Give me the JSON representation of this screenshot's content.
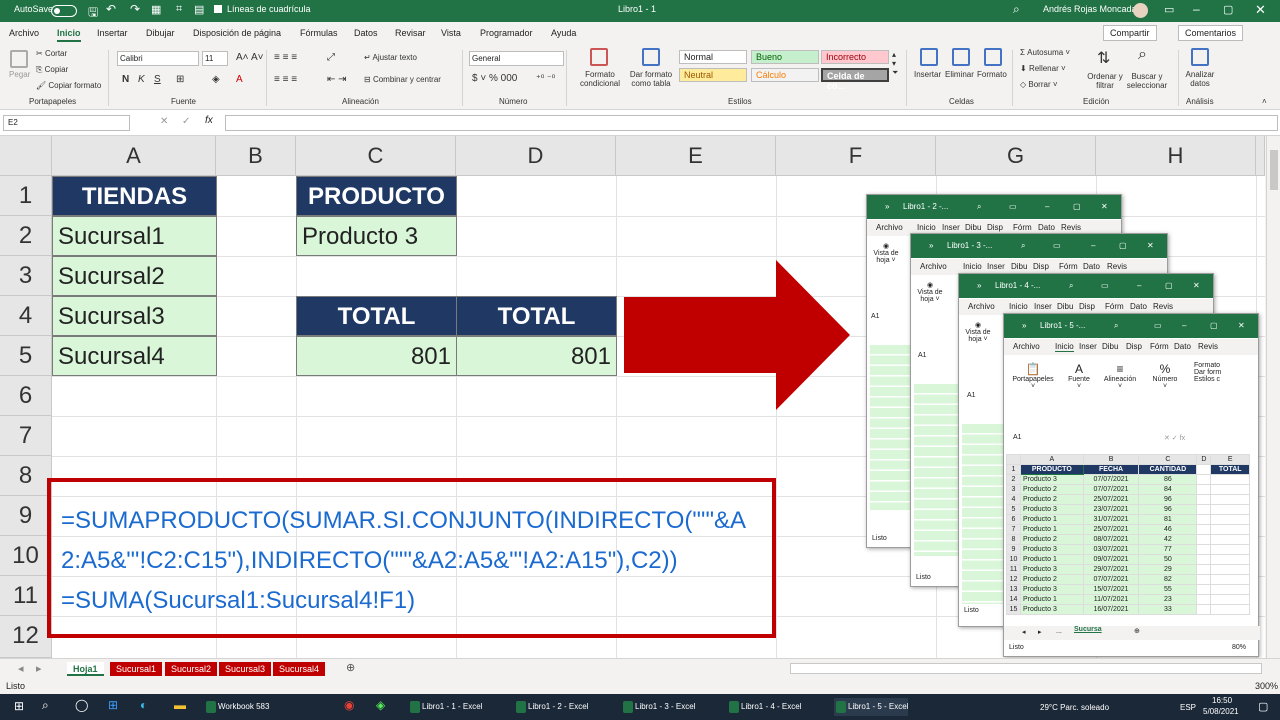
{
  "title_bar": {
    "autosave": "AutoSave",
    "gridlines": "Líneas de cuadrícula",
    "doc_title": "Libro1 - 1",
    "search": "⌕",
    "user": "Andrés Rojas Moncada"
  },
  "ribbon_tabs": [
    "Archivo",
    "Inicio",
    "Insertar",
    "Dibujar",
    "Disposición de página",
    "Fórmulas",
    "Datos",
    "Revisar",
    "Vista",
    "Programador",
    "Ayuda"
  ],
  "share": "Compartir",
  "comments": "Comentarios",
  "ribbon": {
    "clipboard": {
      "paste": "Pegar",
      "cut": "Cortar",
      "copy": "Copiar",
      "format_painter": "Copiar formato",
      "group": "Portapapeles"
    },
    "font": {
      "family": "Calibri",
      "size": "11",
      "bold": "N",
      "italic": "K",
      "underline": "S",
      "group": "Fuente"
    },
    "alignment": {
      "wrap": "Ajustar texto",
      "merge": "Combinar y centrar",
      "group": "Alineación"
    },
    "number": {
      "format": "General",
      "group": "Número"
    },
    "styles": {
      "cond": "Formato condicional",
      "table": "Dar formato como tabla",
      "normal": "Normal",
      "good": "Bueno",
      "bad": "Incorrecto",
      "neutral": "Neutral",
      "calc": "Cálculo",
      "check": "Celda de co...",
      "group": "Estilos"
    },
    "cells": {
      "insert": "Insertar",
      "delete": "Eliminar",
      "format": "Formato",
      "group": "Celdas"
    },
    "editing": {
      "autosum": "Autosuma",
      "fill": "Rellenar",
      "clear": "Borrar",
      "sort": "Ordenar y filtrar",
      "find": "Buscar y seleccionar",
      "group": "Edición"
    },
    "analysis": {
      "analyze": "Analizar datos",
      "group": "Análisis"
    }
  },
  "name_box": "E2",
  "columns": [
    "A",
    "B",
    "C",
    "D",
    "E",
    "F",
    "G",
    "H"
  ],
  "rows": [
    "1",
    "2",
    "3",
    "4",
    "5",
    "6",
    "7",
    "8",
    "9",
    "10",
    "11",
    "12"
  ],
  "cells": {
    "tiendas": "TIENDAS",
    "s1": "Sucursal1",
    "s2": "Sucursal2",
    "s3": "Sucursal3",
    "s4": "Sucursal4",
    "producto_hdr": "PRODUCTO",
    "producto_val": "Producto 3",
    "total1": "TOTAL",
    "total2": "TOTAL",
    "val1": "801",
    "val2": "801"
  },
  "formulas": {
    "line1": "=SUMAPRODUCTO(SUMAR.SI.CONJUNTO(INDIRECTO(\"'\"&A",
    "line2": "2:A5&\"'!C2:C15\"),INDIRECTO(\"'\"&A2:A5&\"'!A2:A15\"),C2))",
    "line3": "=SUMA(Sucursal1:Sucursal4!F1)"
  },
  "windows": [
    {
      "title": "Libro1 - 2 -...",
      "tabs": [
        "Archivo",
        "Inicio",
        "Inser",
        "Dibu",
        "Disp",
        "Fórm",
        "Dato",
        "Revis"
      ]
    },
    {
      "title": "Libro1 - 3 -...",
      "tabs": [
        "Archivo",
        "Inicio",
        "Inser",
        "Dibu",
        "Disp",
        "Fórm",
        "Dato",
        "Revis"
      ]
    },
    {
      "title": "Libro1 - 4 -...",
      "tabs": [
        "Archivo",
        "Inicio",
        "Inser",
        "Dibu",
        "Disp",
        "Fórm",
        "Dato",
        "Revis"
      ]
    },
    {
      "title": "Libro1 - 5 -...",
      "tabs": [
        "Archivo",
        "Inicio",
        "Inser",
        "Dibu",
        "Disp",
        "Fórm",
        "Dato",
        "Revis"
      ]
    }
  ],
  "win5": {
    "namebox": "A1",
    "groups": [
      "Portapapeles",
      "Fuente",
      "Alineación",
      "Número"
    ],
    "styles": [
      "Formato",
      "Dar form",
      "Estilos c"
    ],
    "headers": [
      "PRODUCTO",
      "FECHA",
      "CANTIDAD",
      "TOTAL"
    ],
    "cols": [
      "A",
      "B",
      "C",
      "D",
      "E"
    ],
    "rows": [
      [
        "Producto 3",
        "07/07/2021",
        "86"
      ],
      [
        "Producto 2",
        "07/07/2021",
        "84"
      ],
      [
        "Producto 2",
        "25/07/2021",
        "96"
      ],
      [
        "Producto 3",
        "23/07/2021",
        "96"
      ],
      [
        "Producto 1",
        "31/07/2021",
        "81"
      ],
      [
        "Producto 1",
        "25/07/2021",
        "46"
      ],
      [
        "Producto 2",
        "08/07/2021",
        "42"
      ],
      [
        "Producto 3",
        "03/07/2021",
        "77"
      ],
      [
        "Producto 1",
        "09/07/2021",
        "50"
      ],
      [
        "Producto 3",
        "29/07/2021",
        "29"
      ],
      [
        "Producto 2",
        "07/07/2021",
        "82"
      ],
      [
        "Producto 3",
        "15/07/2021",
        "55"
      ],
      [
        "Producto 1",
        "11/07/2021",
        "23"
      ],
      [
        "Producto 3",
        "16/07/2021",
        "33"
      ]
    ],
    "sheet_tab": "Sucursa",
    "status": "Listo",
    "zoom": "80%"
  },
  "sheet_tabs": [
    "Hoja1",
    "Sucursal1",
    "Sucursal2",
    "Sucursal3",
    "Sucursal4"
  ],
  "status": "Listo",
  "zoom": "300%",
  "taskbar": {
    "apps": [
      "Workbook 583",
      "Libro1 - 1 - Excel",
      "Libro1 - 2 - Excel",
      "Libro1 - 3 - Excel",
      "Libro1 - 4 - Excel",
      "Libro1 - 5 - Excel"
    ],
    "weather": "29°C  Parc. soleado",
    "lang": "ESP",
    "time": "16:50",
    "date": "5/08/2021"
  }
}
